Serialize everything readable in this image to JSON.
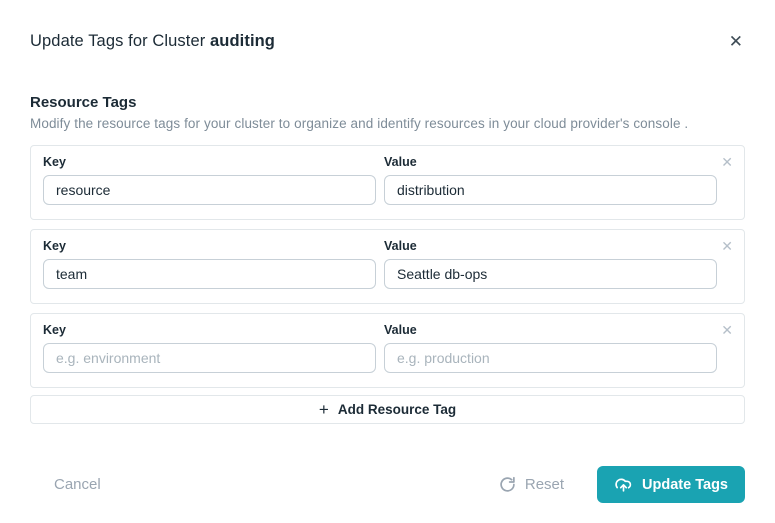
{
  "modal": {
    "title_prefix": "Update Tags for Cluster",
    "cluster_name": "auditing",
    "close_glyph": "✕"
  },
  "section": {
    "heading": "Resource Tags",
    "description": "Modify the resource tags for your cluster to organize and identify resources in your cloud provider's console ."
  },
  "tag_rows": [
    {
      "key_label": "Key",
      "value_label": "Value",
      "key_value": "resource",
      "value_value": "distribution",
      "remove_glyph": "✕"
    },
    {
      "key_label": "Key",
      "value_label": "Value",
      "key_value": "team",
      "value_value": "Seattle db-ops",
      "remove_glyph": "✕"
    },
    {
      "key_label": "Key",
      "value_label": "Value",
      "key_placeholder": "e.g. environment",
      "value_placeholder": "e.g. production",
      "remove_glyph": "✕"
    }
  ],
  "add_button": {
    "plus_glyph": "+",
    "label": "Add Resource Tag"
  },
  "footer": {
    "cancel_label": "Cancel",
    "reset_label": "Reset",
    "update_label": "Update Tags"
  },
  "colors": {
    "accent_teal": "#1aa3b2",
    "muted_text": "#9aa5b1",
    "card_border": "#e2e7ea",
    "input_border": "#c7d0d7",
    "text_dark": "#1c2b36",
    "placeholder": "#a9b4bc"
  }
}
